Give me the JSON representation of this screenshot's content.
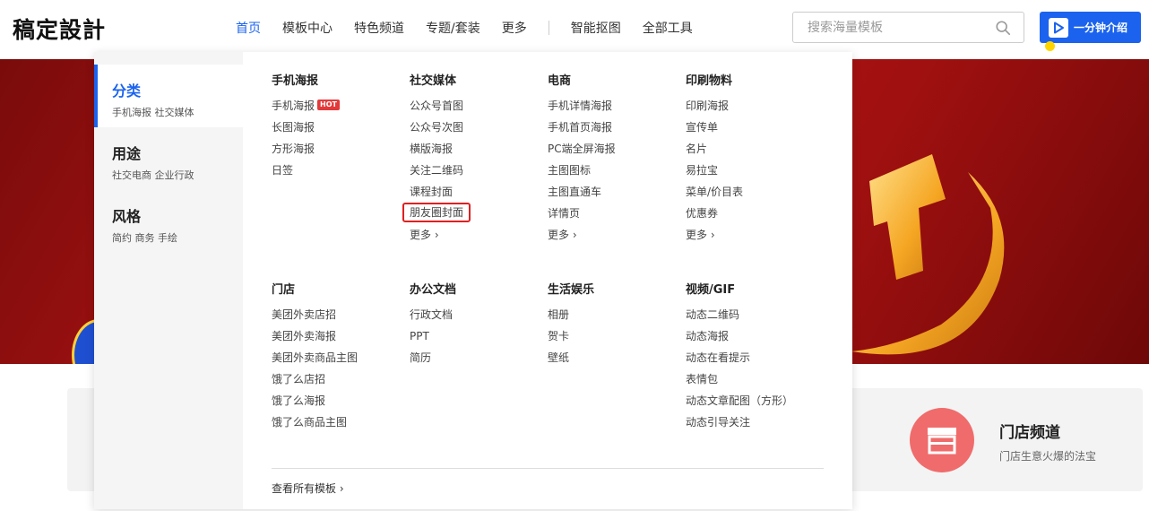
{
  "header": {
    "logo": "稿定設計",
    "nav": [
      {
        "label": "首页",
        "active": true
      },
      {
        "label": "模板中心",
        "active": false
      },
      {
        "label": "特色频道",
        "active": false
      },
      {
        "label": "专题/套装",
        "active": false
      },
      {
        "label": "更多",
        "active": false
      },
      {
        "label": "智能抠图",
        "active": false
      },
      {
        "label": "全部工具",
        "active": false
      }
    ],
    "search_placeholder": "搜索海量模板",
    "intro_label": "一分钟介绍"
  },
  "dropdown": {
    "categories": [
      {
        "title": "分类",
        "sub": "手机海报 社交媒体"
      },
      {
        "title": "用途",
        "sub": "社交电商 企业行政"
      },
      {
        "title": "风格",
        "sub": "简约 商务 手绘"
      }
    ],
    "columns_top": [
      {
        "title": "手机海报",
        "items": [
          "手机海报",
          "长图海报",
          "方形海报",
          "日签"
        ],
        "hot_label": "HOT",
        "more": ""
      },
      {
        "title": "社交媒体",
        "items": [
          "公众号首图",
          "公众号次图",
          "横版海报",
          "关注二维码",
          "课程封面",
          "朋友圈封面"
        ],
        "more": "更多"
      },
      {
        "title": "电商",
        "items": [
          "手机详情海报",
          "手机首页海报",
          "PC端全屏海报",
          "主图图标",
          "主图直通车",
          "详情页"
        ],
        "more": "更多"
      },
      {
        "title": "印刷物料",
        "items": [
          "印刷海报",
          "宣传单",
          "名片",
          "易拉宝",
          "菜单/价目表",
          "优惠券"
        ],
        "more": "更多"
      }
    ],
    "columns_bottom": [
      {
        "title": "门店",
        "items": [
          "美团外卖店招",
          "美团外卖海报",
          "美团外卖商品主图",
          "饿了么店招",
          "饿了么海报",
          "饿了么商品主图"
        ]
      },
      {
        "title": "办公文档",
        "items": [
          "行政文档",
          "PPT",
          "简历"
        ]
      },
      {
        "title": "生活娱乐",
        "items": [
          "相册",
          "贺卡",
          "壁纸"
        ]
      },
      {
        "title": "视频/GIF",
        "items": [
          "动态二维码",
          "动态海报",
          "动态在看提示",
          "表情包",
          "动态文章配图（方形）",
          "动态引导关注"
        ]
      }
    ],
    "view_all": "查看所有模板"
  },
  "store": {
    "title": "门店频道",
    "sub": "门店生意火爆的法宝"
  },
  "colors": {
    "accent": "#1b63ee",
    "highlight": "#e02020",
    "hot": "#e23a3a"
  }
}
